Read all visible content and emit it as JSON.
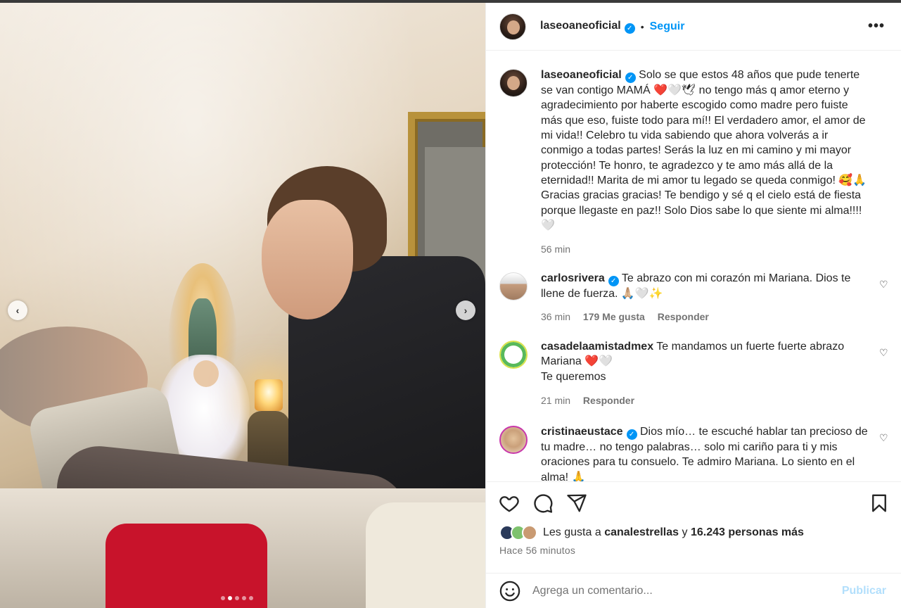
{
  "browser": {
    "url_fragment": "laseoaneoficial"
  },
  "carousel": {
    "prev_label": "‹",
    "next_label": "›",
    "total_slides": 5,
    "active_slide": 2
  },
  "header": {
    "username": "laseoaneoficial",
    "separator": "•",
    "follow_label": "Seguir",
    "more_label": "•••"
  },
  "caption": {
    "username": "laseoaneoficial",
    "text": "Solo se que estos 48 años que pude tenerte se van contigo MAMÁ ❤️🤍🕊 no tengo más q amor eterno y agradecimiento por haberte escogido como madre pero fuiste más que eso, fuiste todo para mí!! El verdadero amor, el amor de mi vida!! Celebro tu vida sabiendo que ahora volverás a ir conmigo a todas partes! Serás la luz en mi camino y mi mayor protección! Te honro, te agradezco y te amo más allá de la eternidad!! Marita de mi amor tu legado se queda conmigo! 🥰🙏 Gracias gracias gracias! Te bendigo y sé q el cielo está de fiesta porque llegaste en paz!! Solo Dios sabe lo que siente mi alma!!!! 🤍",
    "time": "56 min"
  },
  "comments": [
    {
      "username": "carlosrivera",
      "verified": true,
      "text": "Te abrazo con mi corazón mi Mariana. Dios te llene de fuerza. 🙏🏼🤍✨",
      "time": "36 min",
      "likes": "179 Me gusta",
      "reply": "Responder"
    },
    {
      "username": "casadelaamistadmex",
      "verified": false,
      "text": "Te mandamos un fuerte fuerte abrazo Mariana ❤️🤍",
      "text2": "Te queremos",
      "time": "21 min",
      "reply": "Responder"
    },
    {
      "username": "cristinaeustace",
      "verified": true,
      "text": "Dios mío… te escuché hablar tan precioso de tu madre… no tengo palabras… solo mi cariño para ti y mis oraciones para tu consuelo. Te admiro Mariana. Lo siento en el alma! 🙏"
    }
  ],
  "actions": {
    "icons": [
      "heart-icon",
      "comment-icon",
      "share-icon",
      "bookmark-icon"
    ]
  },
  "likes": {
    "prefix": "Les gusta a",
    "user": "canalestrellas",
    "conj": "y",
    "count": "16.243 personas más"
  },
  "posted": "Hace 56 minutos",
  "composer": {
    "placeholder": "Agrega un comentario...",
    "publish_label": "Publicar"
  },
  "colors": {
    "accent": "#0095f6",
    "publish_disabled": "#b2dffc",
    "meta": "#737373",
    "text": "#262626"
  }
}
